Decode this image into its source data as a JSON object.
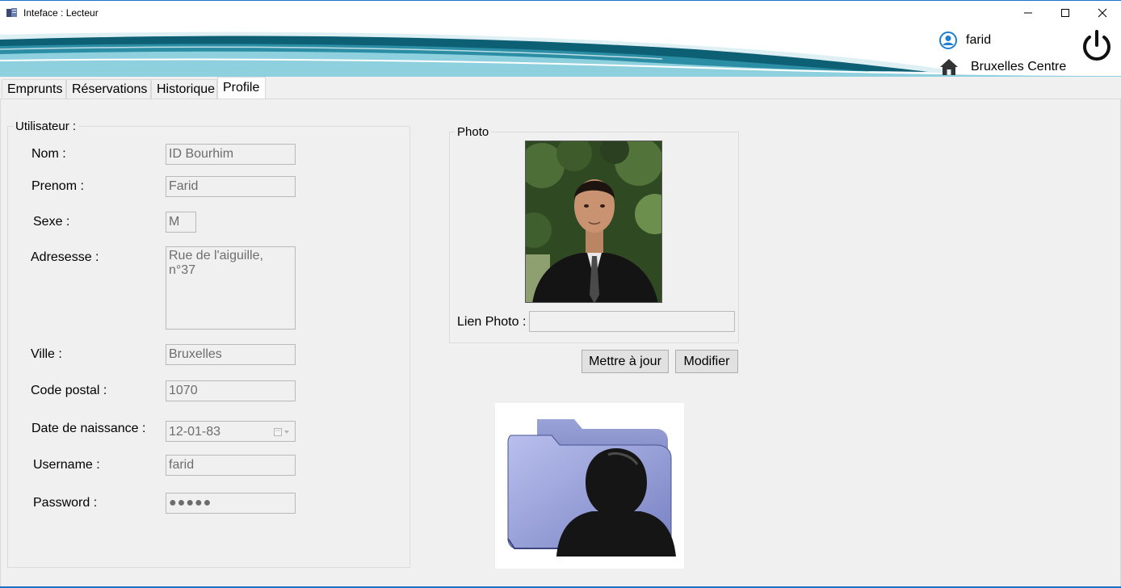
{
  "window": {
    "title": "Inteface : Lecteur",
    "controls": [
      "minimize",
      "maximize",
      "close"
    ]
  },
  "header": {
    "user_name": "farid",
    "branch": "Bruxelles Centre",
    "icons": [
      "user-icon",
      "home-icon",
      "power-icon"
    ]
  },
  "tabs": [
    {
      "label": "Emprunts",
      "active": false
    },
    {
      "label": "Réservations",
      "active": false
    },
    {
      "label": "Historique",
      "active": false
    },
    {
      "label": "Profile",
      "active": true
    }
  ],
  "user_group": {
    "legend": "Utilisateur :",
    "fields": {
      "nom": {
        "label": "Nom :",
        "value": "ID Bourhim"
      },
      "prenom": {
        "label": "Prenom :",
        "value": "Farid"
      },
      "sexe": {
        "label": "Sexe :",
        "value": "M"
      },
      "adresse": {
        "label": "Adresesse :",
        "value": "Rue de l'aiguille, n°37"
      },
      "ville": {
        "label": "Ville :",
        "value": "Bruxelles"
      },
      "code_postal": {
        "label": "Code postal :",
        "value": "1070"
      },
      "date_naissance": {
        "label": "Date de naissance :",
        "value": "12-01-83"
      },
      "username": {
        "label": "Username :",
        "value": "farid"
      },
      "password": {
        "label": "Password :",
        "value": "●●●●●"
      }
    }
  },
  "photo_group": {
    "legend": "Photo",
    "link_label": "Lien Photo :",
    "link_value": ""
  },
  "buttons": {
    "update": "Mettre à jour",
    "modify": "Modifier"
  },
  "colors": {
    "accent": "#1a73c8",
    "wave_dark": "#0d5f74",
    "wave_light": "#7fc6d6",
    "field_border": "#b9b9b9",
    "field_text": "#6d6d6d"
  }
}
